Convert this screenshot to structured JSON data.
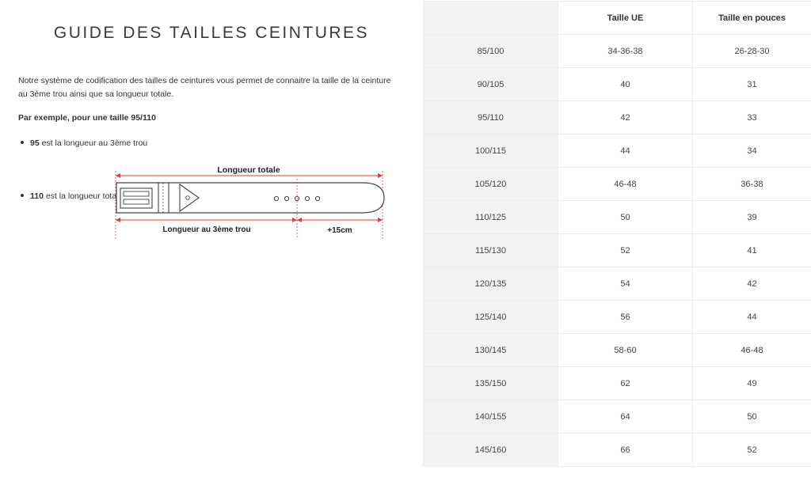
{
  "guide": {
    "title": "GUIDE DES TAILLES CEINTURES",
    "intro": "Notre système de codification des tailles de ceintures vous permet de connaitre la taille de la ceinture au 3ème trou ainsi que sa longueur totale.",
    "example_heading": "Par exemple, pour une taille 95/110",
    "bullets": [
      {
        "strong": "95",
        "text": " est la longueur au 3ème trou"
      },
      {
        "strong": "110",
        "text": " est la longueur total"
      }
    ],
    "diagram": {
      "total_label": "Longueur totale",
      "third_hole_label": "Longueur au 3ème trou",
      "extra_label": "+15cm"
    }
  },
  "size_table": {
    "headers": [
      "",
      "Taille UE",
      "Taille en pouces"
    ],
    "rows": [
      [
        "85/100",
        "34-36-38",
        "26-28-30"
      ],
      [
        "90/105",
        "40",
        "31"
      ],
      [
        "95/110",
        "42",
        "33"
      ],
      [
        "100/115",
        "44",
        "34"
      ],
      [
        "105/120",
        "46-48",
        "36-38"
      ],
      [
        "110/125",
        "50",
        "39"
      ],
      [
        "115/130",
        "52",
        "41"
      ],
      [
        "120/135",
        "54",
        "42"
      ],
      [
        "125/140",
        "56",
        "44"
      ],
      [
        "130/145",
        "58-60",
        "46-48"
      ],
      [
        "135/150",
        "62",
        "49"
      ],
      [
        "140/155",
        "64",
        "50"
      ],
      [
        "145/160",
        "66",
        "52"
      ]
    ]
  },
  "colors": {
    "measure_line": "#e03a3a",
    "belt_outline": "#444444",
    "label_column_bg": "#f3f3f3"
  }
}
